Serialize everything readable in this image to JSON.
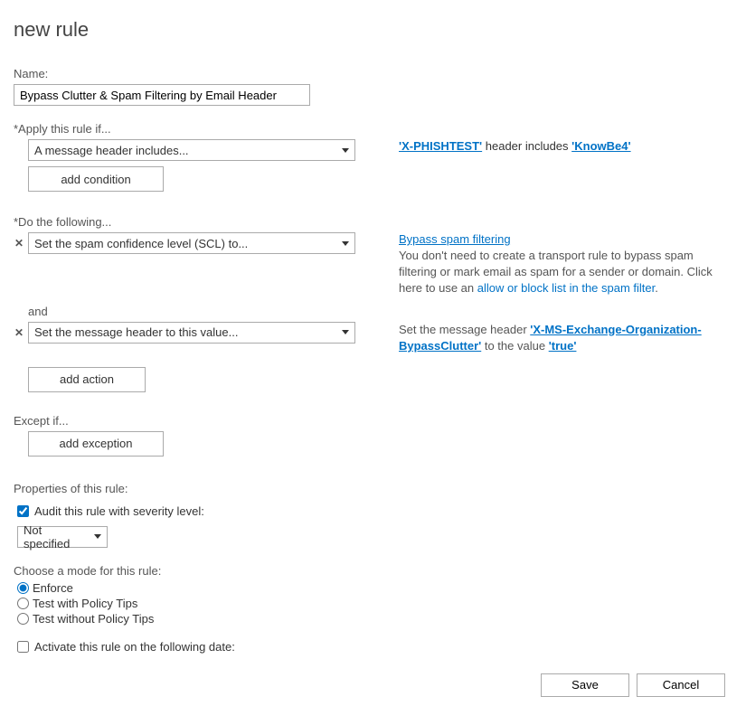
{
  "title": "new rule",
  "name": {
    "label": "Name:",
    "value": "Bypass Clutter & Spam Filtering by Email Header"
  },
  "applyIf": {
    "label": "*Apply this rule if...",
    "dropdown": "A message header includes...",
    "addCondition": "add condition",
    "detail": {
      "headerName": "'X-PHISHTEST'",
      "connector": " header includes ",
      "headerValue": "'KnowBe4'"
    }
  },
  "doFollowing": {
    "label": "*Do the following...",
    "action1": {
      "dropdown": "Set the spam confidence level (SCL) to...",
      "heading": "Bypass spam filtering",
      "text1": "You don't need to create a transport rule to bypass spam filtering or mark email as spam for a sender or domain. Click here to use an ",
      "linkText": "allow or block list in the spam filter",
      "period": "."
    },
    "and": "and",
    "action2": {
      "dropdown": "Set the message header to this value...",
      "text1": "Set the message header ",
      "headerName": "'X-MS-Exchange-Organization-BypassClutter'",
      "text2": " to the value ",
      "headerValue": "'true'"
    },
    "addAction": "add action"
  },
  "exceptIf": {
    "label": "Except if...",
    "addException": "add exception"
  },
  "properties": {
    "label": "Properties of this rule:",
    "auditLabel": "Audit this rule with severity level:",
    "severityDropdown": "Not specified"
  },
  "mode": {
    "label": "Choose a mode for this rule:",
    "enforce": "Enforce",
    "testPolicy": "Test with Policy Tips",
    "testNoPolicy": "Test without Policy Tips"
  },
  "activate": {
    "label": "Activate this rule on the following date:"
  },
  "footer": {
    "save": "Save",
    "cancel": "Cancel"
  }
}
